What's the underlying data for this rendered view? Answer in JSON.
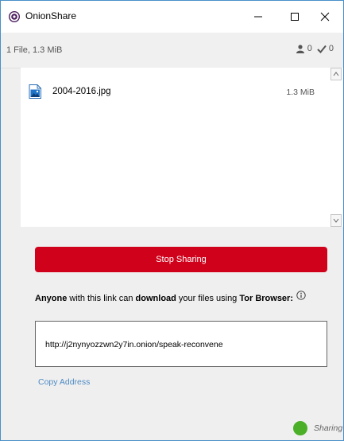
{
  "window": {
    "title": "OnionShare",
    "minimize_label": "—",
    "close_label": "✕"
  },
  "header": {
    "file_summary": "1 File, 1.3 MiB",
    "downloads_in_progress": "0",
    "downloads_completed": "0"
  },
  "files": [
    {
      "name": "2004-2016.jpg",
      "size": "1.3 MiB",
      "icon": "image-file-icon"
    }
  ],
  "stop_button": {
    "label": "Stop Sharing",
    "color": "#d0021b"
  },
  "info": {
    "part1_bold": "Anyone",
    "part2": " with this link can ",
    "part3_bold": "download",
    "part4": " your files using ",
    "part5_bold": "Tor Browser:",
    "icon": "info-icon"
  },
  "share_url": "http://j2nynyozzwn2y7in.onion/speak-reconvene",
  "copy_address_label": "Copy Address",
  "status": {
    "label": "Sharing",
    "color": "#4caf28"
  },
  "colors": {
    "accent_link": "#4e8bc4",
    "window_border": "#4a90c9"
  }
}
